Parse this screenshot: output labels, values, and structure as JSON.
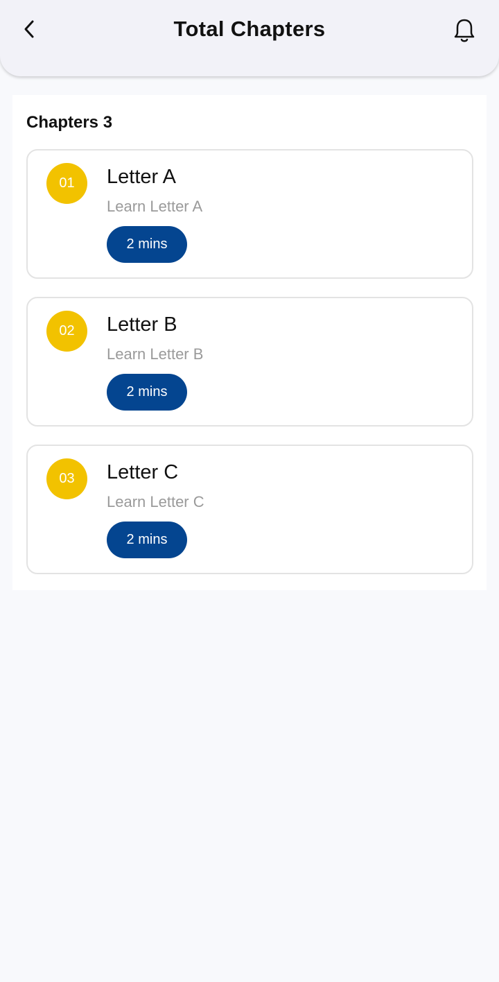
{
  "header": {
    "title": "Total Chapters",
    "back_icon": "chevron-left-icon",
    "bell_icon": "bell-icon"
  },
  "section": {
    "title": "Chapters 3"
  },
  "chapters": [
    {
      "number": "01",
      "title": "Letter A",
      "subtitle": "Learn Letter A",
      "duration": "2 mins"
    },
    {
      "number": "02",
      "title": "Letter B",
      "subtitle": "Learn Letter B",
      "duration": "2 mins"
    },
    {
      "number": "03",
      "title": "Letter C",
      "subtitle": "Learn Letter C",
      "duration": "2 mins"
    }
  ],
  "colors": {
    "badge": "#f2c200",
    "pill": "#044590",
    "header_bg": "#f2f2f8",
    "page_bg": "#f8f9fc"
  }
}
